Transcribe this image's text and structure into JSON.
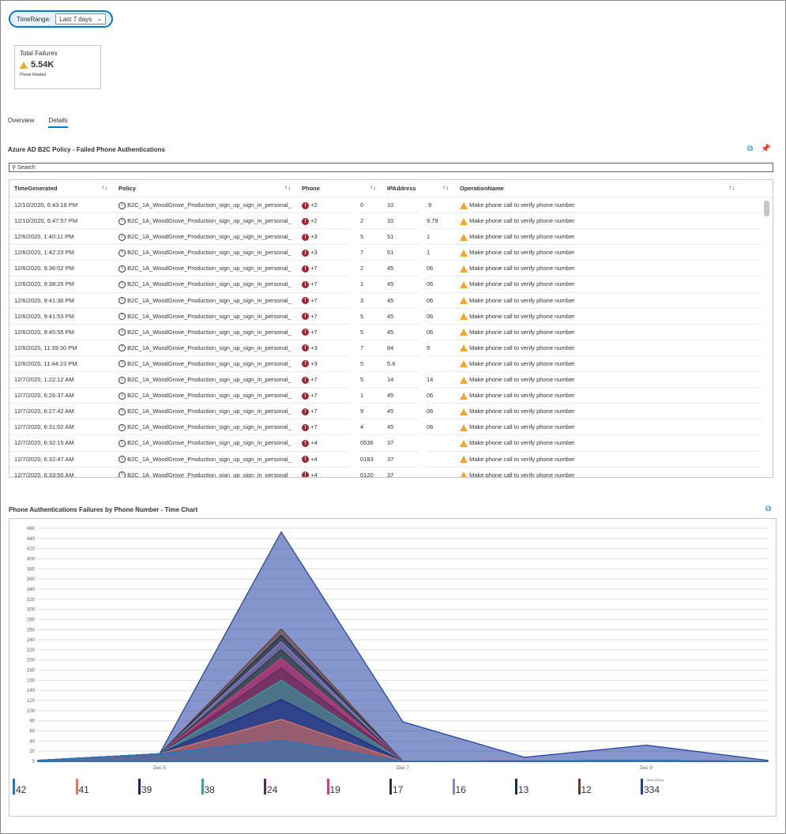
{
  "timerange": {
    "label": "TimeRange:",
    "value": "Last 7 days"
  },
  "tile": {
    "title": "Total Failures",
    "value": "5.54K",
    "subtitle": "Phone Related"
  },
  "tabs": [
    {
      "label": "Overview"
    },
    {
      "label": "Details"
    }
  ],
  "table": {
    "title": "Azure AD B2C Policy - Failed Phone Authentications",
    "search_placeholder": "Search",
    "columns": [
      "TimeGenerated",
      "Policy",
      "Phone",
      "IPAddress",
      "OperationName"
    ],
    "rows": [
      {
        "time": "12/10/2020, 6:43:18 PM",
        "policy": "B2C_1A_WoodGrove_Production_sign_up_sign_in_personal_",
        "phone": "+2",
        "phone_tail": "0",
        "ip": "10",
        "ip_tail": ".9",
        "op": "Make phone call to verify phone number"
      },
      {
        "time": "12/10/2020, 6:47:57 PM",
        "policy": "B2C_1A_WoodGrove_Production_sign_up_sign_in_personal_",
        "phone": "+2",
        "phone_tail": "2",
        "ip": "10",
        "ip_tail": "9.79",
        "op": "Make phone call to verify phone number"
      },
      {
        "time": "12/6/2020, 1:40:11 PM",
        "policy": "B2C_1A_WoodGrove_Production_sign_up_sign_in_personal_",
        "phone": "+3",
        "phone_tail": "5",
        "ip": "51",
        "ip_tail": "1",
        "op": "Make phone call to verify phone number"
      },
      {
        "time": "12/6/2020, 1:42:23 PM",
        "policy": "B2C_1A_WoodGrove_Production_sign_up_sign_in_personal_",
        "phone": "+3",
        "phone_tail": "7",
        "ip": "51",
        "ip_tail": "1",
        "op": "Make phone call to verify phone number"
      },
      {
        "time": "12/6/2020, 9:36:02 PM",
        "policy": "B2C_1A_WoodGrove_Production_sign_up_sign_in_personal_",
        "phone": "+7",
        "phone_tail": "2",
        "ip": "45",
        "ip_tail": "06",
        "op": "Make phone call to verify phone number"
      },
      {
        "time": "12/6/2020, 9:38:25 PM",
        "policy": "B2C_1A_WoodGrove_Production_sign_up_sign_in_personal_",
        "phone": "+7",
        "phone_tail": "1",
        "ip": "45",
        "ip_tail": "06",
        "op": "Make phone call to verify phone number"
      },
      {
        "time": "12/6/2020, 9:41:36 PM",
        "policy": "B2C_1A_WoodGrove_Production_sign_up_sign_in_personal_",
        "phone": "+7",
        "phone_tail": "3",
        "ip": "45",
        "ip_tail": "06",
        "op": "Make phone call to verify phone number"
      },
      {
        "time": "12/6/2020, 9:41:53 PM",
        "policy": "B2C_1A_WoodGrove_Production_sign_up_sign_in_personal_",
        "phone": "+7",
        "phone_tail": "5",
        "ip": "45",
        "ip_tail": "06",
        "op": "Make phone call to verify phone number"
      },
      {
        "time": "12/6/2020, 9:45:55 PM",
        "policy": "B2C_1A_WoodGrove_Production_sign_up_sign_in_personal_",
        "phone": "+7",
        "phone_tail": "5",
        "ip": "45",
        "ip_tail": "06",
        "op": "Make phone call to verify phone number"
      },
      {
        "time": "12/6/2020, 11:39:30 PM",
        "policy": "B2C_1A_WoodGrove_Production_sign_up_sign_in_personal_",
        "phone": "+3",
        "phone_tail": "7",
        "ip": "84",
        "ip_tail": "9",
        "op": "Make phone call to verify phone number"
      },
      {
        "time": "12/6/2020, 11:44:23 PM",
        "policy": "B2C_1A_WoodGrove_Production_sign_up_sign_in_personal_",
        "phone": "+3",
        "phone_tail": "5",
        "ip": "5.6",
        "ip_tail": "",
        "op": "Make phone call to verify phone number"
      },
      {
        "time": "12/7/2020, 1:22:12 AM",
        "policy": "B2C_1A_WoodGrove_Production_sign_up_sign_in_personal_",
        "phone": "+7",
        "phone_tail": "5",
        "ip": "14",
        "ip_tail": "14",
        "op": "Make phone call to verify phone number"
      },
      {
        "time": "12/7/2020, 6:26:37 AM",
        "policy": "B2C_1A_WoodGrove_Production_sign_up_sign_in_personal_",
        "phone": "+7",
        "phone_tail": "1",
        "ip": "45",
        "ip_tail": "06",
        "op": "Make phone call to verify phone number"
      },
      {
        "time": "12/7/2020, 6:27:42 AM",
        "policy": "B2C_1A_WoodGrove_Production_sign_up_sign_in_personal_",
        "phone": "+7",
        "phone_tail": "9",
        "ip": "45",
        "ip_tail": "06",
        "op": "Make phone call to verify phone number"
      },
      {
        "time": "12/7/2020, 6:31:02 AM",
        "policy": "B2C_1A_WoodGrove_Production_sign_up_sign_in_personal_",
        "phone": "+7",
        "phone_tail": "4",
        "ip": "45",
        "ip_tail": "06",
        "op": "Make phone call to verify phone number"
      },
      {
        "time": "12/7/2020, 6:32:15 AM",
        "policy": "B2C_1A_WoodGrove_Production_sign_up_sign_in_personal_",
        "phone": "+4",
        "phone_tail": "0536",
        "ip": "37",
        "ip_tail": "",
        "op": "Make phone call to verify phone number"
      },
      {
        "time": "12/7/2020, 6:32:47 AM",
        "policy": "B2C_1A_WoodGrove_Production_sign_up_sign_in_personal_",
        "phone": "+4",
        "phone_tail": "0183",
        "ip": "37",
        "ip_tail": "",
        "op": "Make phone call to verify phone number"
      },
      {
        "time": "12/7/2020, 6:33:50 AM",
        "policy": "B2C_1A_WoodGrove_Production_sign_up_sign_in_personal_",
        "phone": "+4",
        "phone_tail": "0120",
        "ip": "37",
        "ip_tail": "",
        "op": "Make phone call to verify phone number"
      }
    ]
  },
  "chart_data": {
    "type": "area",
    "title": "Phone Authentications Failures by Phone Number - Time Chart",
    "x": [
      "Dec 4",
      "Dec 5",
      "Dec 6",
      "Dec 7",
      "Dec 8",
      "Dec 9",
      "Dec 10"
    ],
    "x_tick_labels": [
      "Dec 5",
      "Dec 7",
      "Dec 9"
    ],
    "ylim": [
      0,
      460
    ],
    "yticks": [
      0,
      20,
      40,
      60,
      80,
      100,
      120,
      140,
      160,
      180,
      200,
      220,
      240,
      260,
      280,
      300,
      320,
      340,
      360,
      380,
      400,
      420,
      440,
      460
    ],
    "stacked": true,
    "grid": true,
    "legend_position": "bottom",
    "series": [
      {
        "name": "",
        "color": "#1f77c4",
        "values": [
          2,
          15,
          42,
          0,
          1,
          2,
          0
        ]
      },
      {
        "name": "",
        "color": "#e8735a",
        "values": [
          0,
          0,
          41,
          0,
          0,
          0,
          0
        ]
      },
      {
        "name": "",
        "color": "#1b1f8a",
        "values": [
          0,
          0,
          39,
          0,
          0,
          0,
          0
        ]
      },
      {
        "name": "",
        "color": "#2aa6a6",
        "values": [
          0,
          0,
          38,
          0,
          0,
          0,
          0
        ]
      },
      {
        "name": "",
        "color": "#5a2a5a",
        "values": [
          0,
          0,
          24,
          0,
          0,
          0,
          0
        ]
      },
      {
        "name": "",
        "color": "#e3328a",
        "values": [
          0,
          0,
          19,
          0,
          0,
          0,
          0
        ]
      },
      {
        "name": "",
        "color": "#1d3d2a",
        "values": [
          0,
          0,
          17,
          0,
          0,
          0,
          0
        ]
      },
      {
        "name": "",
        "color": "#8f7fd6",
        "values": [
          0,
          0,
          16,
          0,
          0,
          0,
          0
        ]
      },
      {
        "name": "",
        "color": "#13324a",
        "values": [
          0,
          0,
          13,
          0,
          0,
          0,
          0
        ]
      },
      {
        "name": "",
        "color": "#6b3a2a",
        "values": [
          0,
          0,
          12,
          0,
          0,
          0,
          0
        ]
      },
      {
        "name": "Other (Sum)",
        "color": "#1f3fa0",
        "values": [
          0,
          0,
          192,
          78,
          7,
          30,
          2
        ]
      }
    ],
    "legend_values": [
      "42",
      "41",
      "39",
      "38",
      "24",
      "19",
      "17",
      "16",
      "13",
      "12",
      "334"
    ]
  }
}
